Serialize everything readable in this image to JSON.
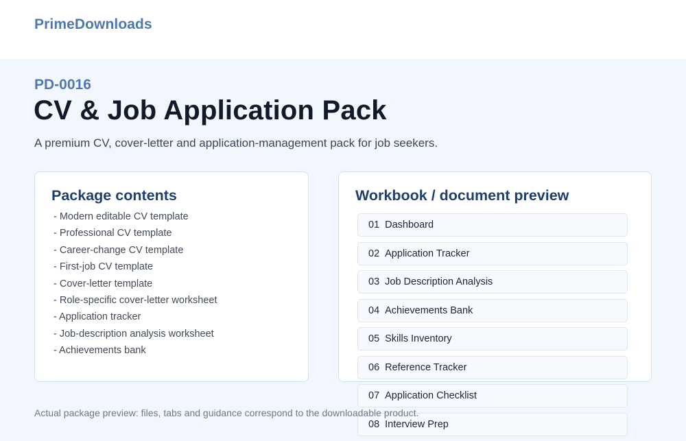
{
  "header": {
    "brand": "PrimeDownloads"
  },
  "product": {
    "sku": "PD-0016",
    "title": "CV & Job Application Pack",
    "subtitle": "A premium CV, cover-letter and application-management pack for job seekers."
  },
  "contents": {
    "heading": "Package contents",
    "items": [
      "- Modern editable CV template",
      "- Professional CV template",
      "- Career-change CV template",
      "- First-job CV template",
      "- Cover-letter template",
      "- Role-specific cover-letter worksheet",
      "- Application tracker",
      "- Job-description analysis worksheet",
      "- Achievements bank"
    ]
  },
  "preview": {
    "heading": "Workbook / document preview",
    "sheets": [
      {
        "num": "01",
        "name": "Dashboard"
      },
      {
        "num": "02",
        "name": "Application Tracker"
      },
      {
        "num": "03",
        "name": "Job Description Analysis"
      },
      {
        "num": "04",
        "name": "Achievements Bank"
      },
      {
        "num": "05",
        "name": "Skills Inventory"
      },
      {
        "num": "06",
        "name": "Reference Tracker"
      },
      {
        "num": "07",
        "name": "Application Checklist"
      },
      {
        "num": "08",
        "name": "Interview Prep"
      }
    ]
  },
  "footnote": "Actual package preview: files, tabs and guidance correspond to the downloadable product."
}
